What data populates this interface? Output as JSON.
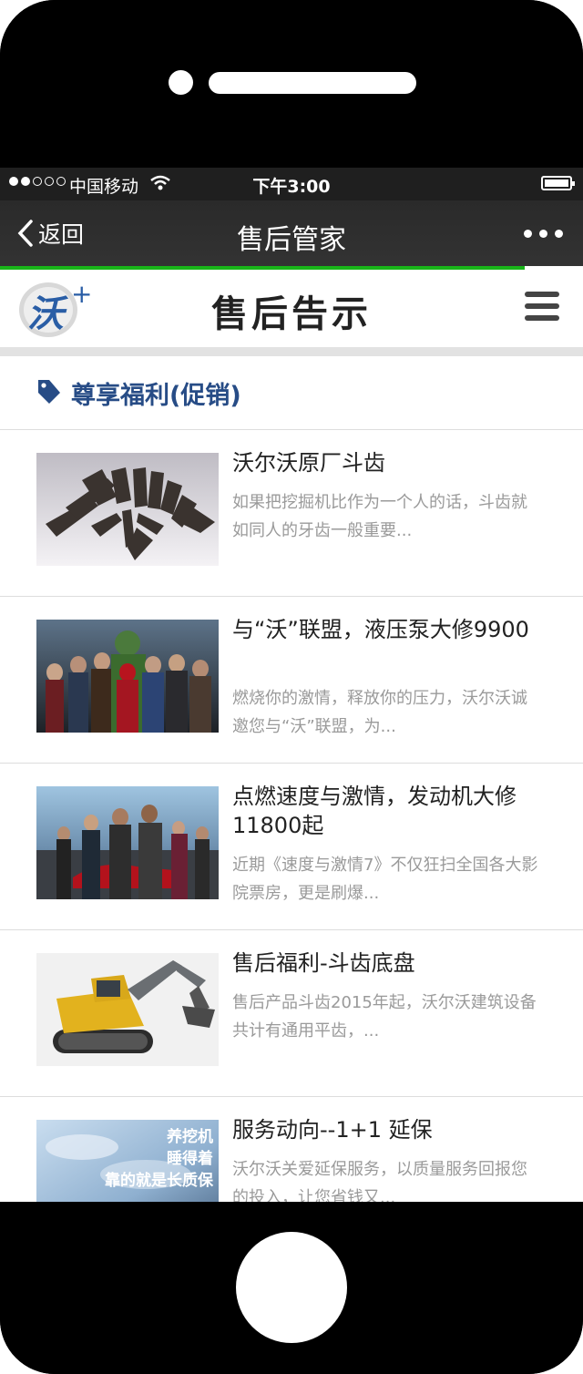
{
  "status": {
    "carrier": "中国移动",
    "time": "下午3:00",
    "signal_filled": 2,
    "signal_total": 5
  },
  "nav": {
    "back_label": "返回",
    "title": "售后管家",
    "progress_percent": 90
  },
  "header": {
    "logo_text": "沃",
    "logo_plus": "+",
    "title": "售后告示"
  },
  "section": {
    "title": "尊享福利(促销)"
  },
  "items": [
    {
      "title": "沃尔沃原厂斗齿",
      "desc": "如果把挖掘机比作为一个人的话，斗齿就如同人的牙齿一般重要...",
      "image": "bucket-teeth-image"
    },
    {
      "title": "与“沃”联盟，液压泵大修9900",
      "desc": "燃烧你的激情，释放你的压力，沃尔沃诚邀您与“沃”联盟，为...",
      "image": "avengers-poster-image"
    },
    {
      "title": "点燃速度与激情，发动机大修11800起",
      "desc": "近期《速度与激情7》不仅狂扫全国各大影院票房，更是刷爆...",
      "image": "fast-furious-poster-image"
    },
    {
      "title": "售后福利-斗齿底盘",
      "desc": "售后产品斗齿2015年起，沃尔沃建筑设备共计有通用平齿，...",
      "image": "excavator-image"
    },
    {
      "title": "服务动向--1+1 延保",
      "desc": "沃尔沃关爱延保服务，以质量服务回报您的投入，让您省钱又...",
      "image": "extended-warranty-image",
      "image_text": [
        "养挖机",
        "睡得着",
        "靠的就是长质保"
      ]
    }
  ],
  "colors": {
    "accent_green": "#18b418",
    "section_blue": "#274c86"
  }
}
